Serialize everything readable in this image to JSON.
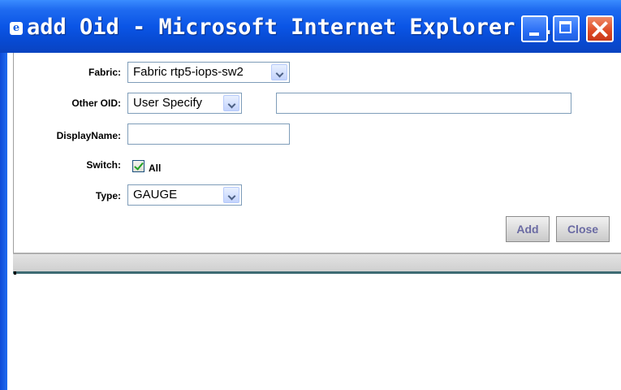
{
  "window": {
    "title": "add Oid - Microsoft Internet Explorer ...",
    "icon": "ie-icon"
  },
  "form": {
    "fabric": {
      "label": "Fabric:",
      "value": "Fabric rtp5-iops-sw2"
    },
    "other_oid": {
      "label": "Other OID:",
      "value": "User Specify",
      "text_value": ""
    },
    "display_name": {
      "label": "DisplayName:",
      "value": ""
    },
    "switch": {
      "label": "Switch:",
      "checkbox_label": "All",
      "checked": true
    },
    "type": {
      "label": "Type:",
      "value": "GAUGE"
    }
  },
  "buttons": {
    "add": "Add",
    "close": "Close"
  },
  "colors": {
    "titlebar": "#0a55e6",
    "close_button": "#dd4a24",
    "button_text": "#6b6ba3",
    "divider": "#3d6b73"
  }
}
